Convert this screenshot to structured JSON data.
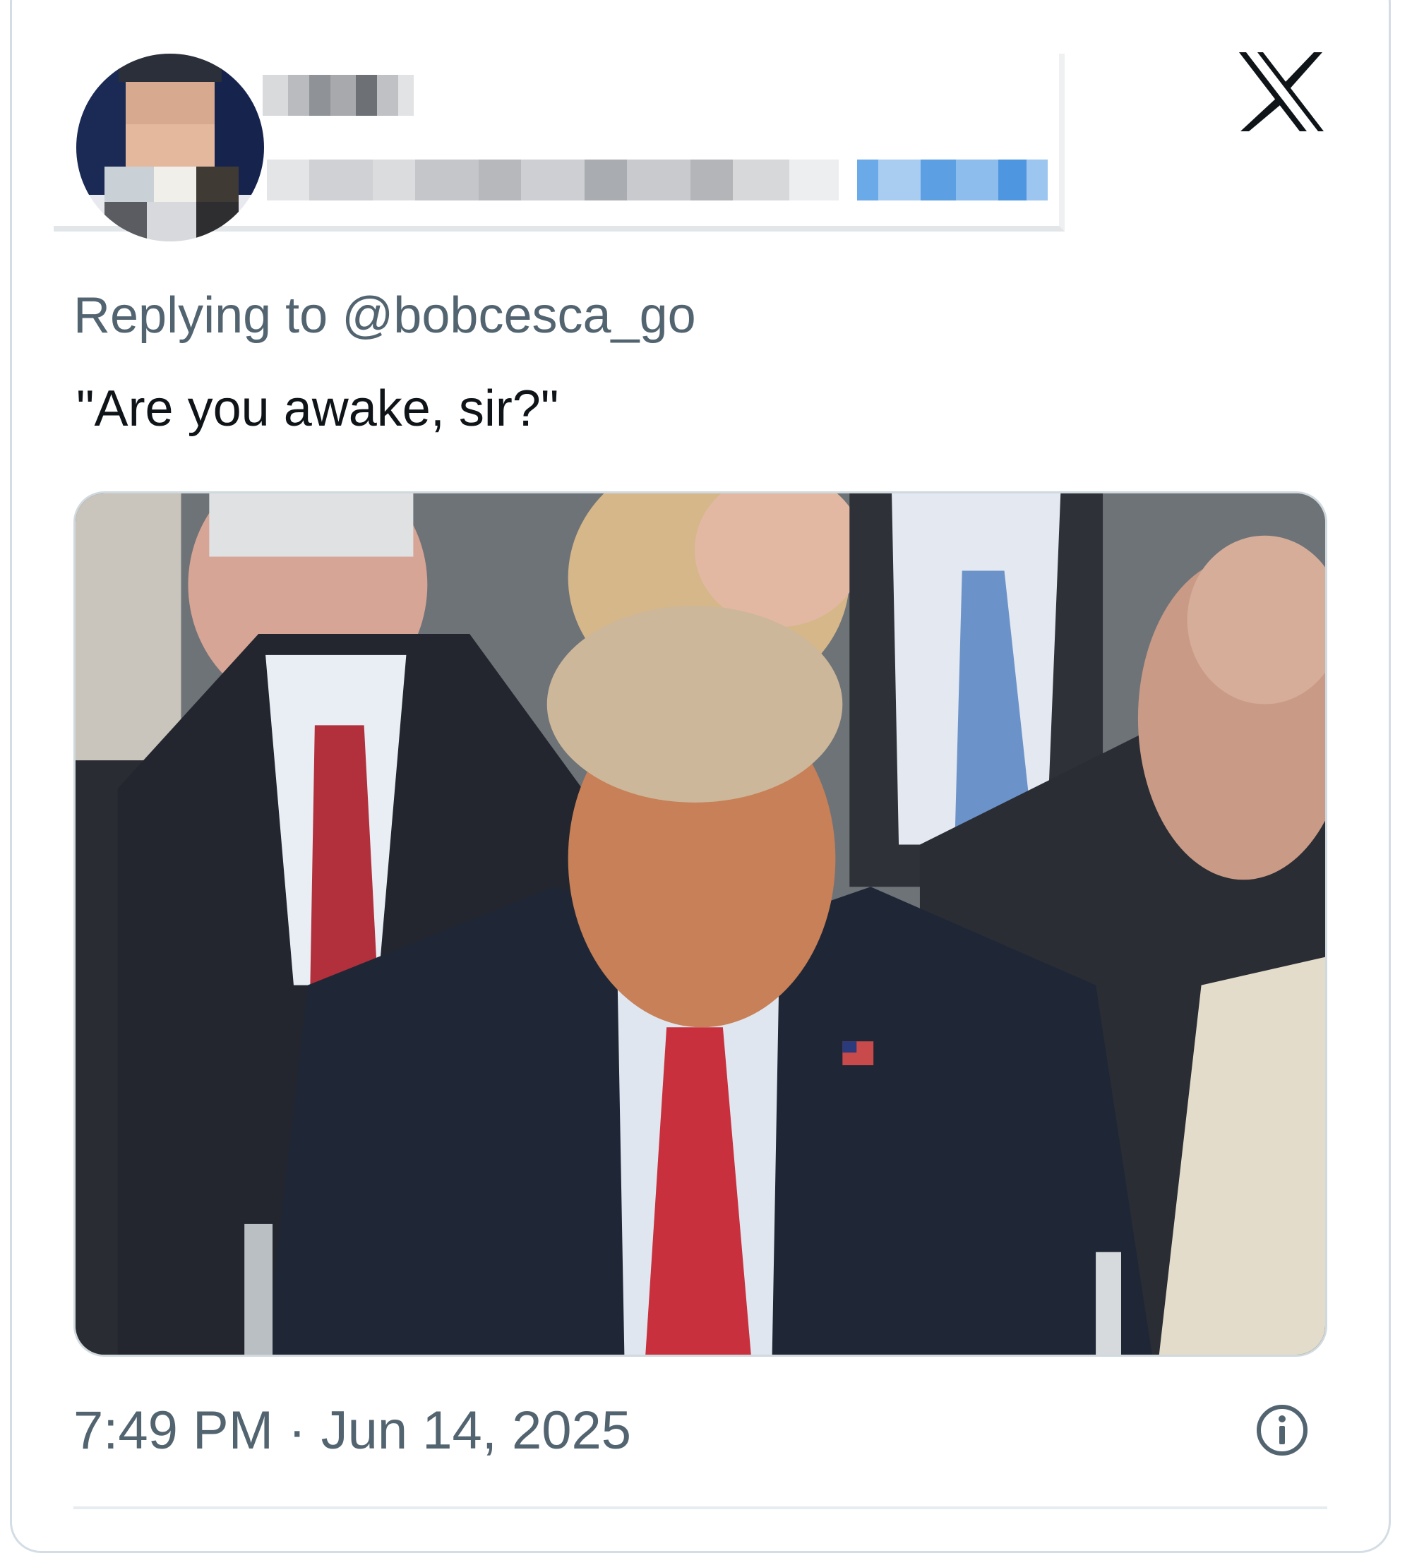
{
  "tweet": {
    "reply_prefix": "Replying to ",
    "reply_handle": "@bobcesca_go",
    "text": "\"Are you awake, sir?\"",
    "timestamp": "7:49 PM · Jun 14, 2025"
  },
  "icons": {
    "brand": "x-logo-icon",
    "info": "info-icon"
  },
  "colors": {
    "secondary_text": "#536471",
    "primary_text": "#0f1419",
    "card_border": "#d4dde5",
    "follow_blue": "#1d9bf0"
  }
}
